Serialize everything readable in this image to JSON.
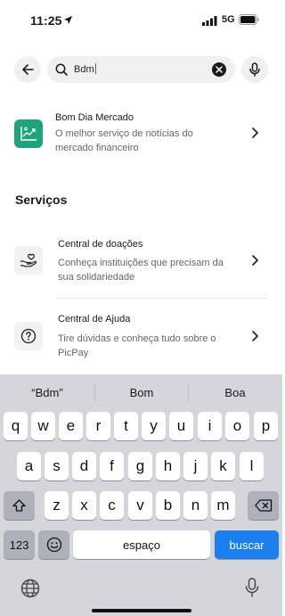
{
  "status_bar": {
    "time": "11:25",
    "network": "5G"
  },
  "search": {
    "value": "Bdm"
  },
  "results": [
    {
      "title": "Bom Dia Mercado",
      "description": "O melhor serviço de notícias do mercado financeiro",
      "icon": "chart-icon",
      "icon_bg": "#1fa37a"
    }
  ],
  "services_heading": "Serviços",
  "services": [
    {
      "title": "Central de doações",
      "description": "Conheça instituições que precisam da sua solidariedade",
      "icon": "donation-icon"
    },
    {
      "title": "Central de Ajuda",
      "description": "Tire dúvidas e conheça tudo sobre o PicPay",
      "icon": "help-icon"
    }
  ],
  "keyboard": {
    "suggestions": [
      "“Bdm”",
      "Bom",
      "Boa"
    ],
    "row1": [
      "q",
      "w",
      "e",
      "r",
      "t",
      "y",
      "u",
      "i",
      "o",
      "p"
    ],
    "row2": [
      "a",
      "s",
      "d",
      "f",
      "g",
      "h",
      "j",
      "k",
      "l"
    ],
    "row3": [
      "z",
      "x",
      "c",
      "v",
      "b",
      "n",
      "m"
    ],
    "numbers_label": "123",
    "space_label": "espaço",
    "action_label": "buscar"
  },
  "colors": {
    "accent_green": "#1fa37a",
    "keyboard_blue": "#1b7ff0"
  }
}
